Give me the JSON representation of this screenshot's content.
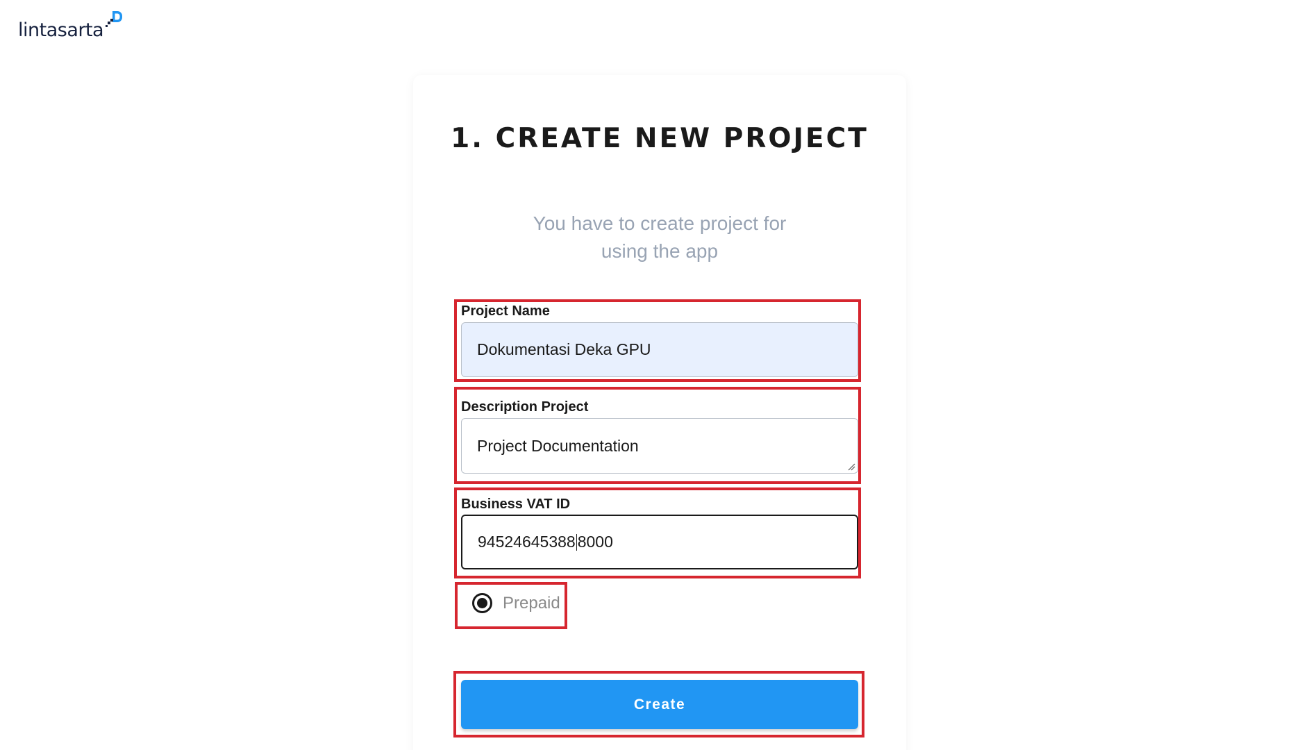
{
  "brand": {
    "name": "lintasarta",
    "color": "#16213e",
    "accent": "#2196f3"
  },
  "form": {
    "title": "1. CREATE NEW PROJECT",
    "subtitle": "You have to create project for using the app",
    "project_name": {
      "label": "Project Name",
      "value": "Dokumentasi Deka GPU"
    },
    "description": {
      "label": "Description Project",
      "value": "Project Documentation"
    },
    "vat_id": {
      "label": "Business VAT ID",
      "value_before_caret": "94524645388",
      "value_after_caret": "8000"
    },
    "billing": {
      "label": "Prepaid",
      "selected": true
    },
    "submit_label": "Create"
  },
  "colors": {
    "annotation_border": "#d6262f",
    "autofill_bg": "#e8f0fe",
    "subtitle_text": "#98a3b3",
    "button_bg": "#2196f3"
  }
}
